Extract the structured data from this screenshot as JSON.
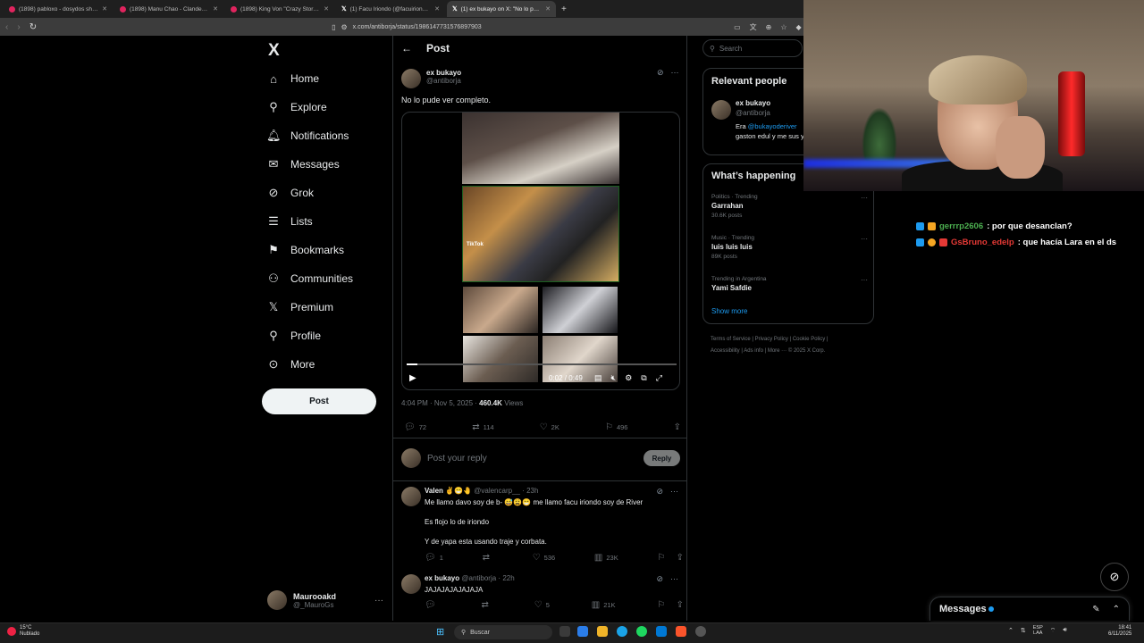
{
  "browser": {
    "tabs": [
      {
        "label": "(1898) pabloxo - dosydos shot by vi",
        "icon": "youtube-icon"
      },
      {
        "label": "(1898) Manu Chao - Clandestino (Of",
        "icon": "youtube-icon"
      },
      {
        "label": "(1898) King Von \"Crazy Story\" (Live P",
        "icon": "youtube-icon"
      },
      {
        "label": "(1) Facu Iriondo (@facuiriondo) / X",
        "icon": "x-icon"
      },
      {
        "label": "(1) ex bukayo on X: \"No lo pude",
        "icon": "x-icon",
        "active": true
      }
    ],
    "url": "x.com/antiborja/status/1986147731576897903"
  },
  "nav": {
    "logo": "X",
    "items": [
      {
        "label": "Home",
        "icon": "home-icon"
      },
      {
        "label": "Explore",
        "icon": "search-icon"
      },
      {
        "label": "Notifications",
        "icon": "bell-icon"
      },
      {
        "label": "Messages",
        "icon": "envelope-icon"
      },
      {
        "label": "Grok",
        "icon": "grok-icon"
      },
      {
        "label": "Lists",
        "icon": "list-icon"
      },
      {
        "label": "Bookmarks",
        "icon": "bookmark-icon"
      },
      {
        "label": "Communities",
        "icon": "people-icon"
      },
      {
        "label": "Premium",
        "icon": "x-premium-icon"
      },
      {
        "label": "Profile",
        "icon": "user-icon"
      },
      {
        "label": "More",
        "icon": "more-circle-icon"
      }
    ],
    "post_label": "Post",
    "account": {
      "name": "Maurooakd",
      "handle": "@_MauroGs"
    }
  },
  "post": {
    "header_title": "Post",
    "author_name": "ex bukayo",
    "author_handle": "@antiborja",
    "text": "No lo pude ver completo.",
    "video": {
      "watermark": "TikTok",
      "time": "0:02 / 0:49",
      "progress": 0.04
    },
    "time": "4:04 PM · Nov 5, 2025",
    "views_count": "460.4K",
    "views_label": "Views",
    "stats": {
      "replies": "72",
      "reposts": "114",
      "likes": "2K",
      "bookmarks": "496"
    },
    "reply_placeholder": "Post your reply",
    "reply_button": "Reply"
  },
  "replies": [
    {
      "name": "Valen ✌️😁🤚",
      "handle": "@valencarp__",
      "age": "23h",
      "lines": [
        "Me llamo davo soy de b- 😅😩😁 me llamo facu iriondo soy de River",
        "Es flojo lo de iriondo",
        "Y de yapa esta usando traje y corbata."
      ],
      "stats": {
        "replies": "1",
        "reposts": "",
        "likes": "536",
        "views": "23K"
      }
    },
    {
      "name": "ex bukayo",
      "handle": "@antiborja",
      "age": "22h",
      "lines": [
        "JAJAJAJAJAJAJA"
      ],
      "stats": {
        "replies": "",
        "reposts": "",
        "likes": "5",
        "views": "21K"
      }
    }
  ],
  "sidebar": {
    "search_placeholder": "Search",
    "relevant": {
      "title": "Relevant people",
      "name": "ex bukayo",
      "handle": "@antiborja",
      "bio_prefix": "Era ",
      "bio_mention": "@bukayoderiver",
      "bio_rest": "gaston edul y me sus y Rock and Roll."
    },
    "happening": {
      "title": "What’s happening",
      "trends": [
        {
          "context": "Politics · Trending",
          "topic": "Garrahan",
          "posts": "30.6K posts"
        },
        {
          "context": "Music · Trending",
          "topic": "luis luis luis",
          "posts": "89K posts"
        },
        {
          "context": "Trending in Argentina",
          "topic": "Yami Safdie",
          "posts": ""
        }
      ],
      "show_more": "Show more"
    },
    "footer": [
      "Terms of Service",
      "Privacy Policy",
      "Cookie Policy",
      "Accessibility",
      "Ads info",
      "More ···",
      "© 2025 X Corp."
    ]
  },
  "chat": [
    {
      "user": "gerrrp2606",
      "message": ": por que desanclan?",
      "color": "#4caf50"
    },
    {
      "user": "GsBruno_edelp",
      "message": ": que hacía Lara en el ds",
      "color": "#e53935"
    }
  ],
  "messages_drawer": {
    "title": "Messages"
  },
  "taskbar": {
    "weather_temp": "15°C",
    "weather_desc": "Nublado",
    "search_label": "Buscar",
    "lang_top": "ESP",
    "lang_bottom": "LAA",
    "time": "18:41",
    "date": "6/11/2025"
  }
}
